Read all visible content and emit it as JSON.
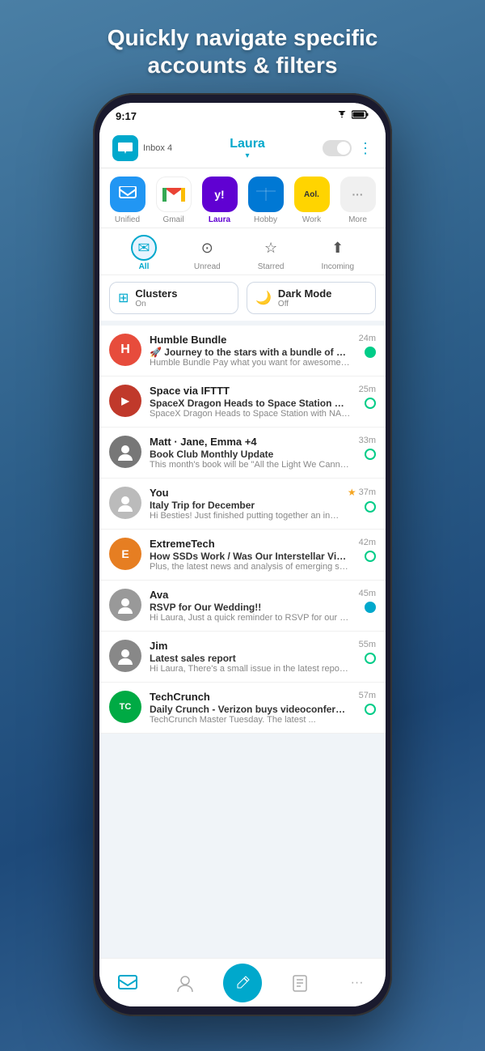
{
  "header": {
    "line1": "Quickly navigate specific",
    "line2": "accounts & filters"
  },
  "status_bar": {
    "time": "9:17",
    "wifi_icon": "wifi",
    "battery_icon": "battery"
  },
  "top_nav": {
    "inbox_label": "Inbox 4",
    "account_name": "Laura",
    "dropdown_char": "▾",
    "menu_icon": "⋮"
  },
  "accounts": [
    {
      "id": "unified",
      "label": "Unified",
      "icon": "📦",
      "active": false
    },
    {
      "id": "gmail",
      "label": "Gmail",
      "icon": "M",
      "active": false
    },
    {
      "id": "yahoo",
      "label": "Laura",
      "icon": "y!",
      "active": true
    },
    {
      "id": "hobby",
      "label": "Hobby",
      "icon": "📅",
      "active": false
    },
    {
      "id": "work",
      "label": "Work",
      "icon": "Aol.",
      "active": false
    },
    {
      "id": "more",
      "label": "More",
      "icon": "···",
      "active": false
    }
  ],
  "filters": [
    {
      "id": "all",
      "label": "All",
      "active": true
    },
    {
      "id": "unread",
      "label": "Unread",
      "active": false
    },
    {
      "id": "starred",
      "label": "Starred",
      "active": false
    },
    {
      "id": "incoming",
      "label": "Incoming",
      "active": false
    }
  ],
  "features": [
    {
      "id": "clusters",
      "icon": "⊞",
      "title": "Clusters",
      "sub": "On"
    },
    {
      "id": "darkmode",
      "icon": "🌙",
      "title": "Dark Mode",
      "sub": "Off"
    }
  ],
  "emails": [
    {
      "id": "humble-bundle",
      "sender": "Humble Bundle",
      "avatar_color": "#e74c3c",
      "avatar_text": "H",
      "time": "24m",
      "subject": "🚀 Journey to the stars with a bundle of Stardock strategy ...",
      "preview": "Humble Bundle Pay what you want for awesome games a...",
      "unread": true,
      "starred": false,
      "dot_style": "outline"
    },
    {
      "id": "space-ifttt",
      "sender": "Space via IFTTT",
      "avatar_color": "#e74c3c",
      "avatar_text": "▶",
      "time": "25m",
      "subject": "SpaceX Dragon Heads to Space Station with NASA Scienc...",
      "preview": "SpaceX Dragon Heads to Space Station with NASA Scienc...",
      "unread": true,
      "starred": false,
      "dot_style": "outline"
    },
    {
      "id": "matt-group",
      "sender": "Matt · Jane, Emma +4",
      "avatar_color": "#555",
      "avatar_text": "👤",
      "time": "33m",
      "subject": "Book Club Monthly Update",
      "preview": "This month's book will be \"All the Light We Cannot See\" by ...",
      "unread": true,
      "starred": false,
      "dot_style": "outline"
    },
    {
      "id": "you",
      "sender": "You",
      "avatar_color": "#aaa",
      "avatar_text": "👤",
      "time": "37m",
      "subject": "Italy Trip for December",
      "preview": "Hi Besties! Just finished putting together an initial itinerary...",
      "unread": true,
      "starred": true,
      "dot_style": "outline"
    },
    {
      "id": "extremetech",
      "sender": "ExtremeTech",
      "avatar_color": "#e67e22",
      "avatar_text": "E",
      "time": "42m",
      "subject": "How SSDs Work / Was Our Interstellar Visitor Torn Apart b...",
      "preview": "Plus, the latest news and analysis of emerging science an...",
      "unread": true,
      "starred": false,
      "dot_style": "outline"
    },
    {
      "id": "ava",
      "sender": "Ava",
      "avatar_color": "#888",
      "avatar_text": "👤",
      "time": "45m",
      "subject": "RSVP for Our Wedding!!",
      "preview": "Hi Laura, Just a quick reminder to RSVP for our wedding. I'll nee...",
      "unread": true,
      "starred": false,
      "dot_style": "filled-blue"
    },
    {
      "id": "jim",
      "sender": "Jim",
      "avatar_color": "#777",
      "avatar_text": "👤",
      "time": "55m",
      "subject": "Latest sales report",
      "preview": "Hi Laura, There's a small issue in the latest report that was...",
      "unread": true,
      "starred": false,
      "dot_style": "outline"
    },
    {
      "id": "techcrunch",
      "sender": "TechCrunch",
      "avatar_color": "#00aa44",
      "avatar_text": "TC",
      "time": "57m",
      "subject": "Daily Crunch - Verizon buys videoconferencing company B...",
      "preview": "TechCrunch Master Tuesday. The latest ...",
      "unread": true,
      "starred": false,
      "dot_style": "outline"
    }
  ],
  "bottom_nav": [
    {
      "id": "inbox",
      "icon": "✉",
      "active": true
    },
    {
      "id": "contacts",
      "icon": "👤",
      "active": false
    },
    {
      "id": "compose",
      "icon": "✏",
      "active": false,
      "is_compose": true
    },
    {
      "id": "tasks",
      "icon": "📋",
      "active": false
    },
    {
      "id": "more",
      "icon": "···",
      "active": false
    }
  ]
}
